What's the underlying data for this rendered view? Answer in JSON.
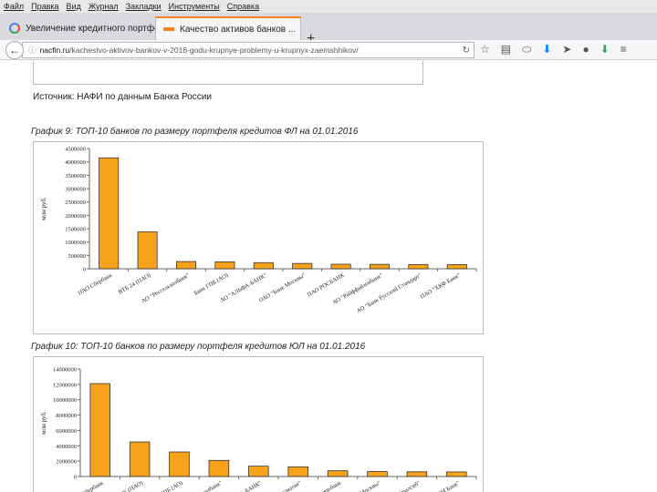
{
  "menu": [
    "Файл",
    "Правка",
    "Вид",
    "Журнал",
    "Закладки",
    "Инструменты",
    "Справка"
  ],
  "tabs": [
    {
      "title": "Увеличение кредитного портфеля крупнейших...",
      "close": "×"
    },
    {
      "title": "Качество активов банков ...",
      "close": "×"
    }
  ],
  "new_tab": "+",
  "url": {
    "host": "nacfin.ru",
    "path": "/kachestvo-aktivov-bankov-v-2016-godu-krupnye-problemy-u-krupnyx-zaemshhikov/"
  },
  "page": {
    "source": "Источник: НАФИ по данным Банка России",
    "chart1_title": "График 9: ТОП-10 банков по размеру портфеля кредитов ФЛ на 01.01.2016",
    "chart2_title": "График 10: ТОП-10 банков по размеру портфеля кредитов ЮЛ на 01.01.2016"
  },
  "colors": {
    "bar": "#f7a21b",
    "bar_stroke": "#333333",
    "accent": "#f58220"
  },
  "chart_data": [
    {
      "type": "bar",
      "title": "",
      "ylabel": "млн руб.",
      "ylim": [
        0,
        4500000
      ],
      "yticks": [
        "0",
        "500000",
        "1000000",
        "1500000",
        "2000000",
        "2500000",
        "3000000",
        "3500000",
        "4000000",
        "4500000"
      ],
      "categories": [
        "ПАО Сбербанк",
        "ВТБ 24 (ПАО)",
        "АО \"Россельхозбанк\"",
        "Банк ГПБ (АО)",
        "АО \"АЛЬФА-БАНК\"",
        "ОАО \"Банк Москвы\"",
        "ПАО РОСБАНК",
        "АО \"Райффайзенбанк\"",
        "АО \"Банк Русский Стандарт\"",
        "ПАО \"ХКФ Банк\""
      ],
      "values": [
        4150000,
        1380000,
        270000,
        260000,
        230000,
        200000,
        170000,
        165000,
        160000,
        155000
      ]
    },
    {
      "type": "bar",
      "title": "",
      "ylabel": "млн руб.",
      "ylim": [
        0,
        14000000
      ],
      "yticks": [
        "0",
        "2000000",
        "4000000",
        "6000000",
        "8000000",
        "10000000",
        "12000000",
        "14000000"
      ],
      "categories": [
        "ПАО Сбербанк",
        "ВТБ (ПАО)",
        "Банк ГПБ (АО)",
        "АО \"Россельхозбанк\"",
        "АО \"АЛЬФА-БАНК\"",
        "ПАО \"ФК Открытие\"",
        "ПАО Промсвязьбанк",
        "ОАО \"Банк Москвы\"",
        "ПАО \"Банк Уралсиб\"",
        "ПАО \"МДМ Банк\""
      ],
      "values": [
        12100000,
        4500000,
        3200000,
        2100000,
        1350000,
        1250000,
        750000,
        650000,
        620000,
        600000
      ]
    }
  ]
}
